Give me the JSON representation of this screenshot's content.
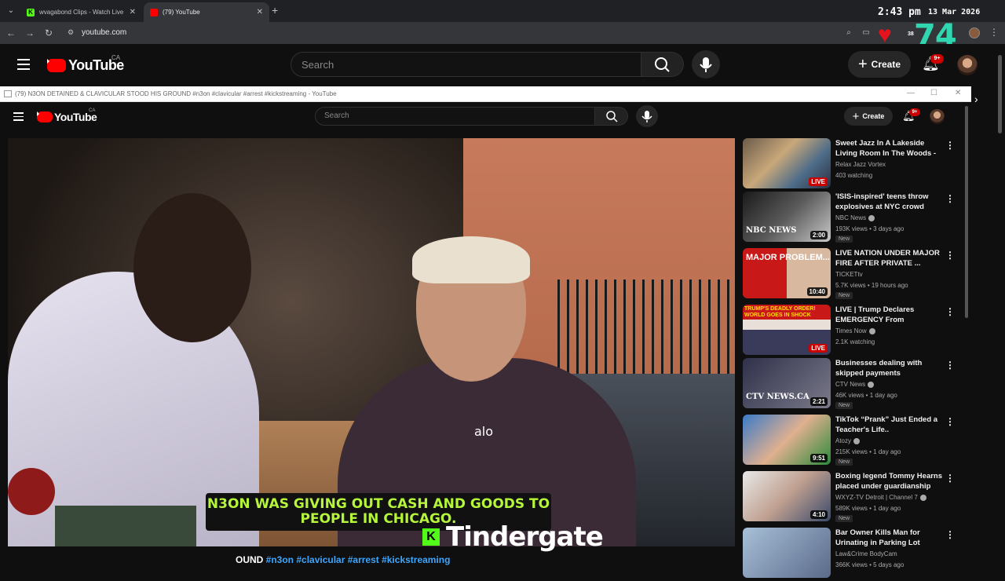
{
  "browser": {
    "tabs": [
      {
        "title": "wvagabond Clips - Watch Live ..."
      },
      {
        "title": "(79) YouTube"
      }
    ],
    "time": "2:43 pm",
    "date": "13 Mar 2026",
    "url": "youtube.com"
  },
  "overlay": {
    "like_count_small": "38",
    "big_number": "74"
  },
  "outer_header": {
    "country": "CA",
    "search_placeholder": "Search",
    "create_label": "Create",
    "notif_badge": "9+"
  },
  "window": {
    "title": "(79) N3ON DETAINED & CLAVICULAR STOOD HIS GROUND #n3on #clavicular #arrest #kickstreaming - YouTube"
  },
  "inner_header": {
    "country": "CA",
    "search_placeholder": "Search",
    "create_label": "Create",
    "notif_badge": "9+"
  },
  "video": {
    "shirt_logo": "alo",
    "caption": "N3ON WAS GIVING OUT CASH AND GOODS TO PEOPLE IN CHICAGO.",
    "brand_letter": "K",
    "stream_title": "Tindergate",
    "title_start": "OUND ",
    "title_tags": "#n3on #clavicular #arrest #kickstreaming"
  },
  "recommendations": [
    {
      "title": "Sweet Jazz In A Lakeside Living Room In The Woods - Smooth ...",
      "channel": "Relax Jazz Vortex",
      "meta": "403 watching",
      "badge": "LIVE",
      "verified": false,
      "new": ""
    },
    {
      "title": "'ISIS-inspired' teens throw explosives at NYC crowd",
      "channel": "NBC News",
      "meta": "193K views • 3 days ago",
      "badge": "2:00",
      "verified": true,
      "new": "New",
      "thumb_text": "NBC NEWS"
    },
    {
      "title": "LIVE NATION UNDER MAJOR FIRE AFTER PRIVATE ...",
      "channel": "TICKETtv",
      "meta": "5.7K views • 19 hours ago",
      "badge": "10:40",
      "verified": false,
      "new": "New",
      "thumb_text": "MAJOR PROBLEM..."
    },
    {
      "title": "LIVE | Trump Declares EMERGENCY From Whitehous...",
      "channel": "Times Now",
      "meta": "2.1K watching",
      "badge": "LIVE",
      "verified": true,
      "new": "",
      "thumb_text": "TRUMP'S DEADLY ORDER! WORLD GOES IN SHOCK"
    },
    {
      "title": "Businesses dealing with skipped payments",
      "channel": "CTV News",
      "meta": "46K views • 1 day ago",
      "badge": "2:21",
      "verified": true,
      "new": "New",
      "thumb_text": "CTV NEWS.CA"
    },
    {
      "title": "TikTok “Prank” Just Ended a Teacher's Life..",
      "channel": "Atozy",
      "meta": "215K views • 1 day ago",
      "badge": "9:51",
      "verified": true,
      "new": "New"
    },
    {
      "title": "Boxing legend Tommy Hearns placed under guardianship an...",
      "channel": "WXYZ-TV Detroit | Channel 7",
      "meta": "589K views • 1 day ago",
      "badge": "4:10",
      "verified": true,
      "new": "New"
    },
    {
      "title": "Bar Owner Kills Man for Urinating in Parking Lot",
      "channel": "Law&Crime BodyCam",
      "meta": "366K views • 5 days ago",
      "badge": "",
      "verified": false,
      "new": ""
    }
  ]
}
